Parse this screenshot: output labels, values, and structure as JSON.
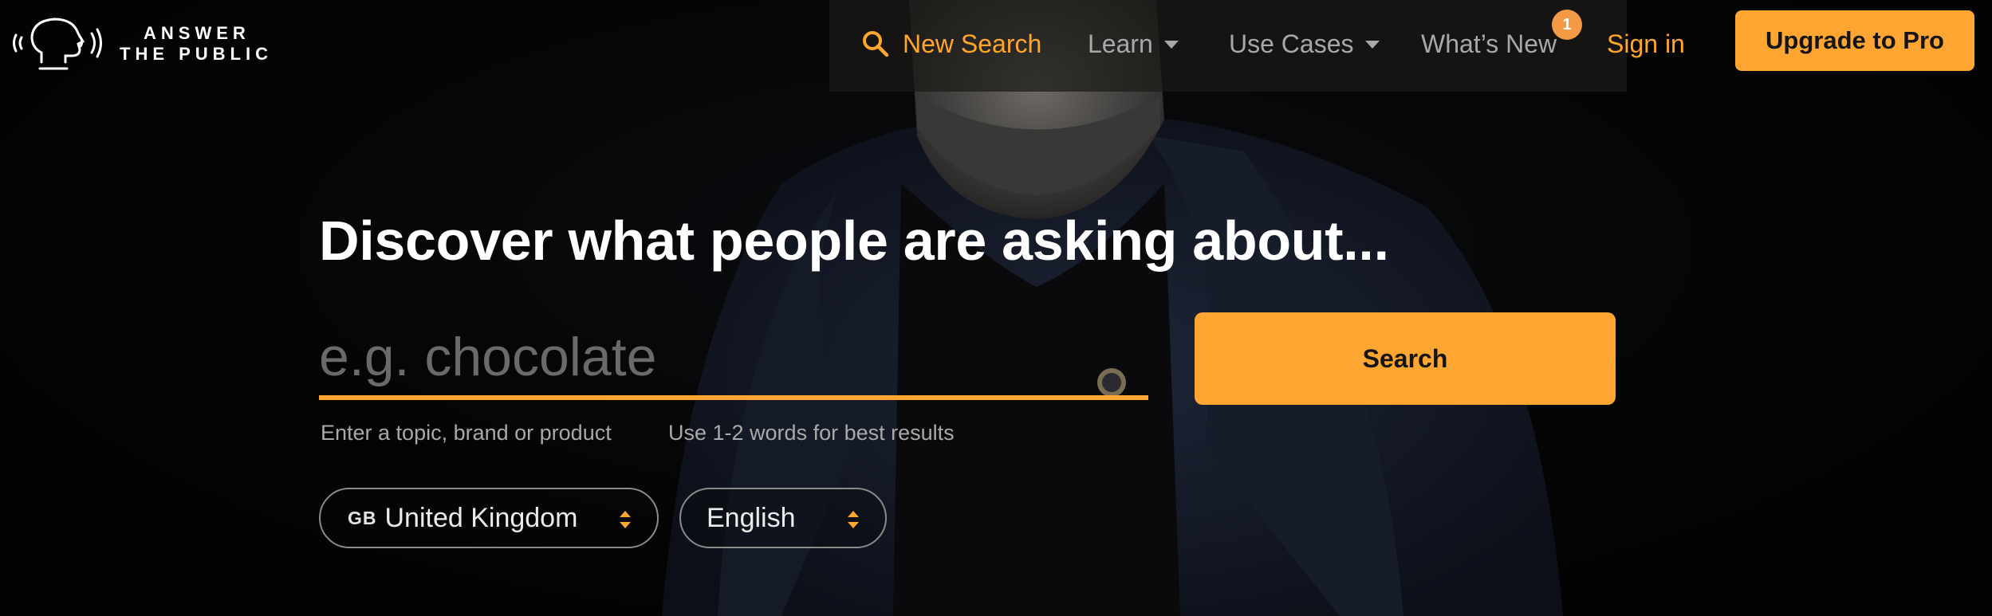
{
  "brand": {
    "line1": "ANSWER",
    "line2": "THE PUBLIC"
  },
  "nav": {
    "new_search": "New Search",
    "learn": "Learn",
    "use_cases": "Use Cases",
    "whats_new": "What’s New",
    "whats_new_badge": "1",
    "sign_in": "Sign in",
    "upgrade": "Upgrade to Pro"
  },
  "hero": {
    "title": "Discover what people are asking about...",
    "search_placeholder": "e.g. chocolate",
    "search_value": "",
    "search_button": "Search",
    "hint_left": "Enter a topic, brand or product",
    "hint_right": "Use 1-2 words for best results"
  },
  "selectors": {
    "country_code": "GB",
    "country": "United Kingdom",
    "language": "English"
  },
  "colors": {
    "accent": "#ffa632",
    "badge": "#f49a45",
    "background": "#050505"
  }
}
